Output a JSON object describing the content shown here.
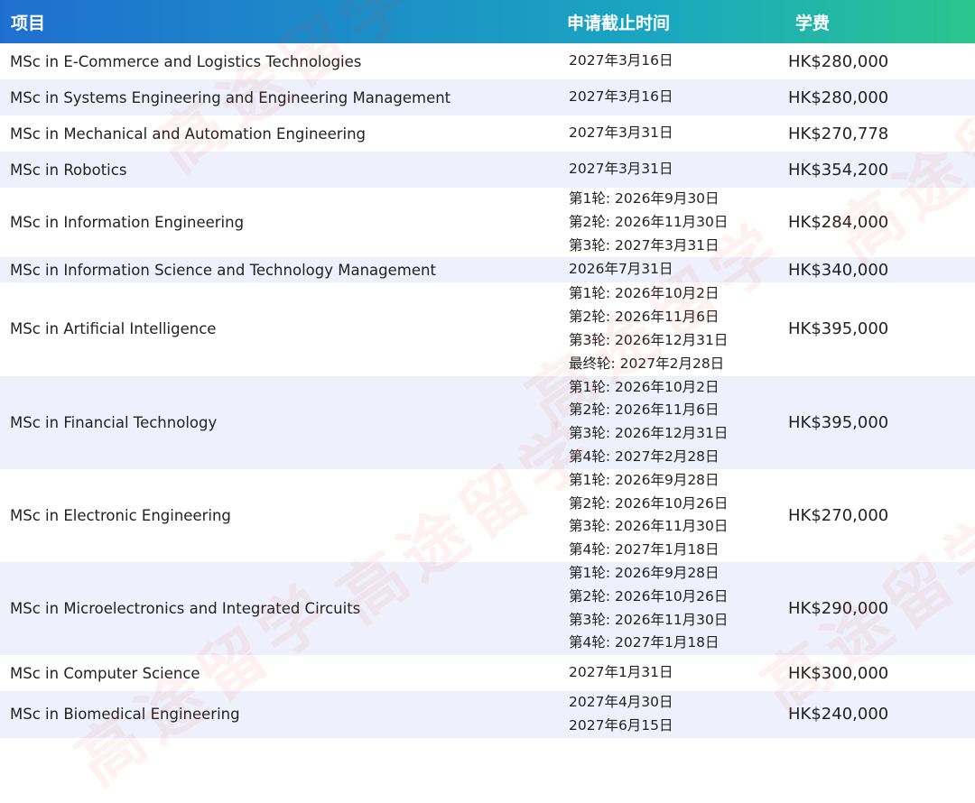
{
  "header": {
    "program": "项目",
    "deadline": "申请截止时间",
    "fee": "学费"
  },
  "rows": [
    {
      "program": "MSc in E-Commerce and Logistics Technologies",
      "deadlines": [
        "2027年3月16日"
      ],
      "fee": "HK$280,000"
    },
    {
      "program": "MSc in Systems Engineering and Engineering Management",
      "deadlines": [
        "2027年3月16日"
      ],
      "fee": "HK$280,000"
    },
    {
      "program": "MSc in Mechanical and Automation Engineering",
      "deadlines": [
        "2027年3月31日"
      ],
      "fee": "HK$270,778"
    },
    {
      "program": "MSc in Robotics",
      "deadlines": [
        "2027年3月31日"
      ],
      "fee": "HK$354,200"
    },
    {
      "program": "MSc in Information Engineering",
      "deadlines": [
        "第1轮: 2026年9月30日",
        "第2轮: 2026年11月30日",
        "第3轮: 2027年3月31日"
      ],
      "fee": "HK$284,000"
    },
    {
      "program": "MSc in Information Science and Technology Management",
      "deadlines": [
        "2026年7月31日"
      ],
      "fee": "HK$340,000"
    },
    {
      "program": "MSc in Artificial Intelligence",
      "deadlines": [
        "第1轮: 2026年10月2日",
        "第2轮: 2026年11月6日",
        "第3轮: 2026年12月31日",
        "最终轮: 2027年2月28日"
      ],
      "fee": "HK$395,000"
    },
    {
      "program": "MSc in Financial Technology",
      "deadlines": [
        "第1轮: 2026年10月2日",
        "第2轮: 2026年11月6日",
        "第3轮: 2026年12月31日",
        "第4轮: 2027年2月28日"
      ],
      "fee": "HK$395,000"
    },
    {
      "program": "MSc in Electronic Engineering",
      "deadlines": [
        "第1轮: 2026年9月28日",
        "第2轮: 2026年10月26日",
        "第3轮: 2026年11月30日",
        "第4轮: 2027年1月18日"
      ],
      "fee": "HK$270,000"
    },
    {
      "program": "MSc in Microelectronics and Integrated Circuits",
      "deadlines": [
        "第1轮: 2026年9月28日",
        "第2轮: 2026年10月26日",
        "第3轮: 2026年11月30日",
        "第4轮: 2027年1月18日"
      ],
      "fee": "HK$290,000"
    },
    {
      "program": "MSc in Computer Science",
      "deadlines": [
        "2027年1月31日"
      ],
      "fee": "HK$300,000"
    },
    {
      "program": "MSc in Biomedical Engineering",
      "deadlines": [
        "2027年4月30日",
        "2027年6月15日"
      ],
      "fee": "HK$240,000"
    }
  ],
  "watermark": {
    "text": "高途留学",
    "color": "#e23c3c"
  }
}
